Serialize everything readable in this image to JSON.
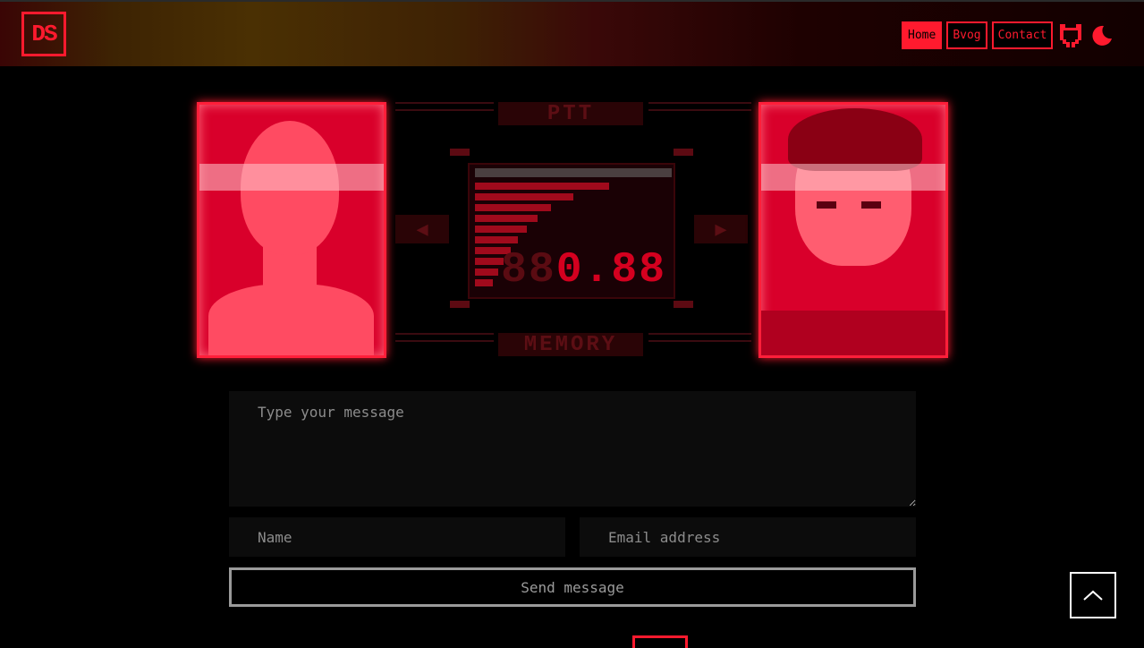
{
  "header": {
    "logo_text": "DS",
    "nav": [
      {
        "label": "Home",
        "active": true
      },
      {
        "label": "Bvog",
        "active": false
      },
      {
        "label": "Contact",
        "active": false
      }
    ],
    "icons": [
      "github-icon",
      "theme-toggle-icon"
    ]
  },
  "codec": {
    "top_label": "PTT",
    "bottom_label": "MEMORY",
    "frequency_dim": "88",
    "frequency_lit": "0.88",
    "left_arrow": "◀",
    "right_arrow": "▶"
  },
  "form": {
    "message_placeholder": "Type your message",
    "name_placeholder": "Name",
    "email_placeholder": "Email address",
    "send_label": "Send message"
  },
  "colors": {
    "accent": "#ff1a2e",
    "background": "#000000",
    "field_bg": "#0c0c0c"
  }
}
